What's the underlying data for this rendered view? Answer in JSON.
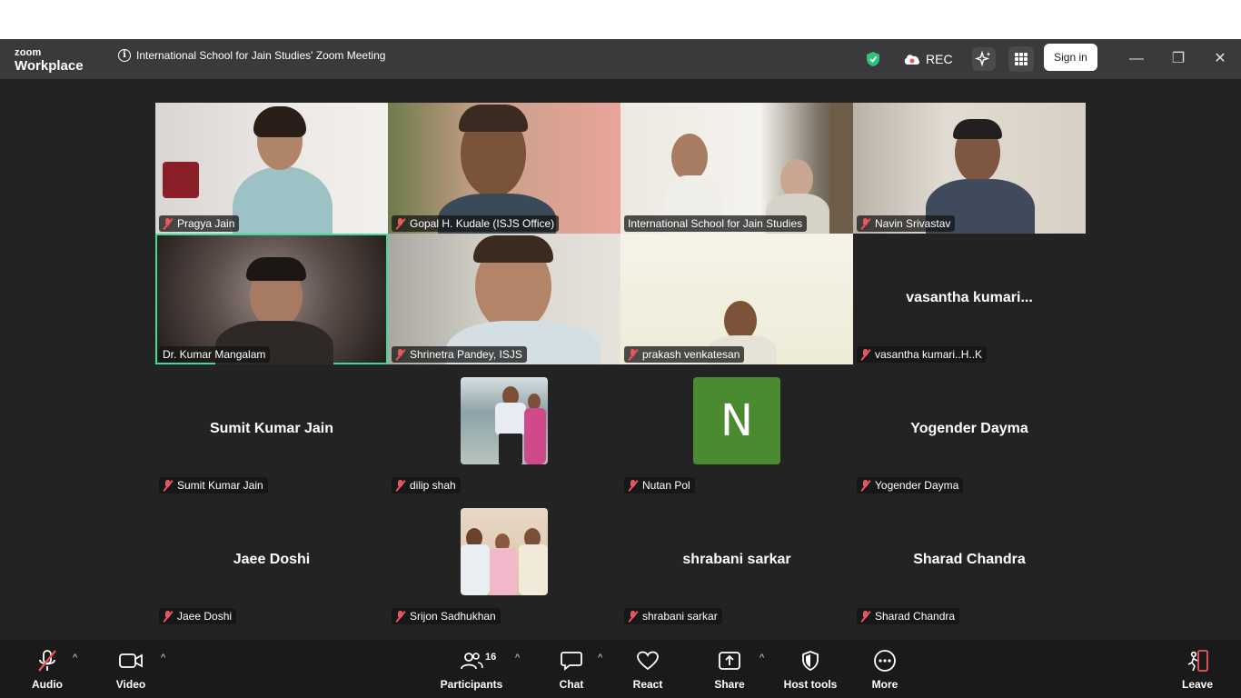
{
  "app": {
    "brand_line1": "zoom",
    "brand_line2": "Workplace"
  },
  "meeting": {
    "title": "International School for Jain Studies' Zoom Meeting",
    "rec_label": "REC",
    "signin_label": "Sign in"
  },
  "window": {
    "minimize": "—",
    "restore": "❐",
    "close": "✕"
  },
  "participants": [
    {
      "name": "Pragya Jain",
      "muted": true,
      "video": true
    },
    {
      "name": "Gopal H. Kudale (ISJS Office)",
      "muted": true,
      "video": true
    },
    {
      "name": "International School for Jain Studies",
      "muted": false,
      "video": true
    },
    {
      "name": "Navin Srivastav",
      "muted": true,
      "video": true
    },
    {
      "name": "Dr. Kumar Mangalam",
      "muted": false,
      "video": true,
      "active_speaker": true
    },
    {
      "name": "Shrinetra Pandey, ISJS",
      "muted": true,
      "video": true
    },
    {
      "name": "prakash venkatesan",
      "muted": true,
      "video": true
    },
    {
      "name": "vasantha kumari..H..K",
      "display": "vasantha  kumari...",
      "muted": true,
      "video": false
    },
    {
      "name": "Sumit Kumar Jain",
      "display": "Sumit Kumar Jain",
      "muted": true,
      "video": false
    },
    {
      "name": "dilip shah",
      "muted": true,
      "video": false,
      "photo": true
    },
    {
      "name": "Nutan Pol",
      "muted": true,
      "video": false,
      "initial": "N"
    },
    {
      "name": "Yogender Dayma",
      "display": "Yogender Dayma",
      "muted": true,
      "video": false
    },
    {
      "name": "Jaee Doshi",
      "display": "Jaee Doshi",
      "muted": true,
      "video": false
    },
    {
      "name": "Srijon Sadhukhan",
      "muted": true,
      "video": false,
      "photo": true
    },
    {
      "name": "shrabani sarkar",
      "display": "shrabani sarkar",
      "muted": true,
      "video": false
    },
    {
      "name": "Sharad Chandra",
      "display": "Sharad Chandra",
      "muted": true,
      "video": false
    }
  ],
  "toolbar": {
    "audio": "Audio",
    "video": "Video",
    "participants": "Participants",
    "participants_count": "16",
    "chat": "Chat",
    "react": "React",
    "share": "Share",
    "host_tools": "Host tools",
    "more": "More",
    "leave": "Leave",
    "caret": "^"
  },
  "colors": {
    "accent_speaker": "#3ddc97",
    "leave": "#e8585b",
    "avatar_n": "#4a8a30",
    "titlebar": "#3a3a3c",
    "stage": "#232323"
  }
}
